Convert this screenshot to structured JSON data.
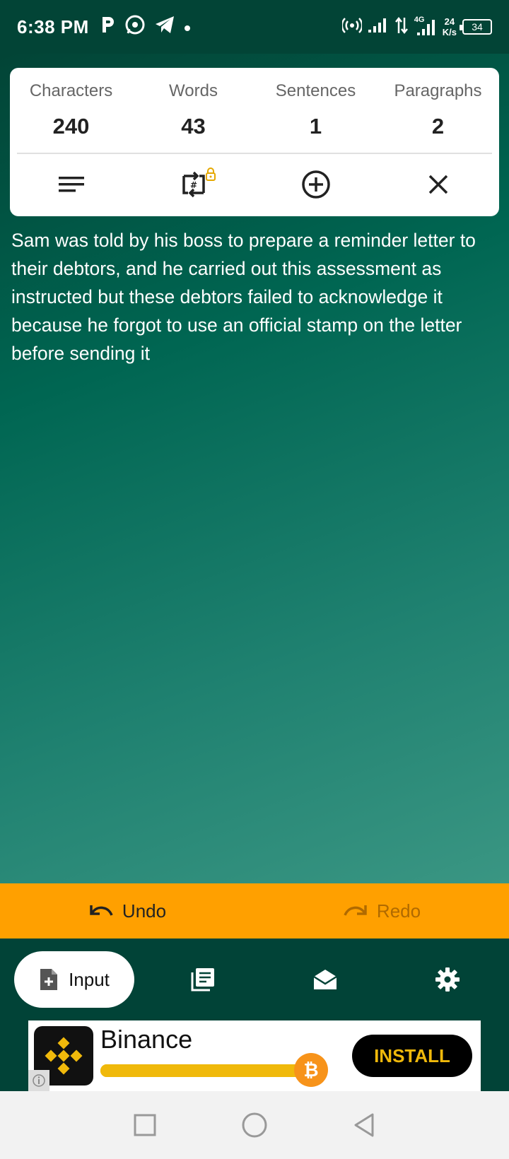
{
  "status_bar": {
    "time": "6:38 PM",
    "net_speed_value": "24",
    "net_speed_unit": "K/s",
    "network_label": "4G",
    "battery": "34"
  },
  "stats": [
    {
      "label": "Characters",
      "value": "240"
    },
    {
      "label": "Words",
      "value": "43"
    },
    {
      "label": "Sentences",
      "value": "1"
    },
    {
      "label": "Paragraphs",
      "value": "2"
    }
  ],
  "tools": {
    "hash_icon_glyph": "#"
  },
  "editor": {
    "text": "Sam was told by his boss to prepare a reminder letter to their debtors, and he carried out this assessment as instructed but these debtors failed to acknowledge it because he forgot to use an official stamp on the letter before sending it"
  },
  "history": {
    "undo_label": "Undo",
    "redo_label": "Redo"
  },
  "nav": {
    "input_label": "Input"
  },
  "ad": {
    "title": "Binance",
    "install_label": "INSTALL",
    "coin_glyph": "₿"
  },
  "colors": {
    "accent": "#ffa000",
    "dark_green": "#014337",
    "binance_yellow": "#f0b90b"
  }
}
